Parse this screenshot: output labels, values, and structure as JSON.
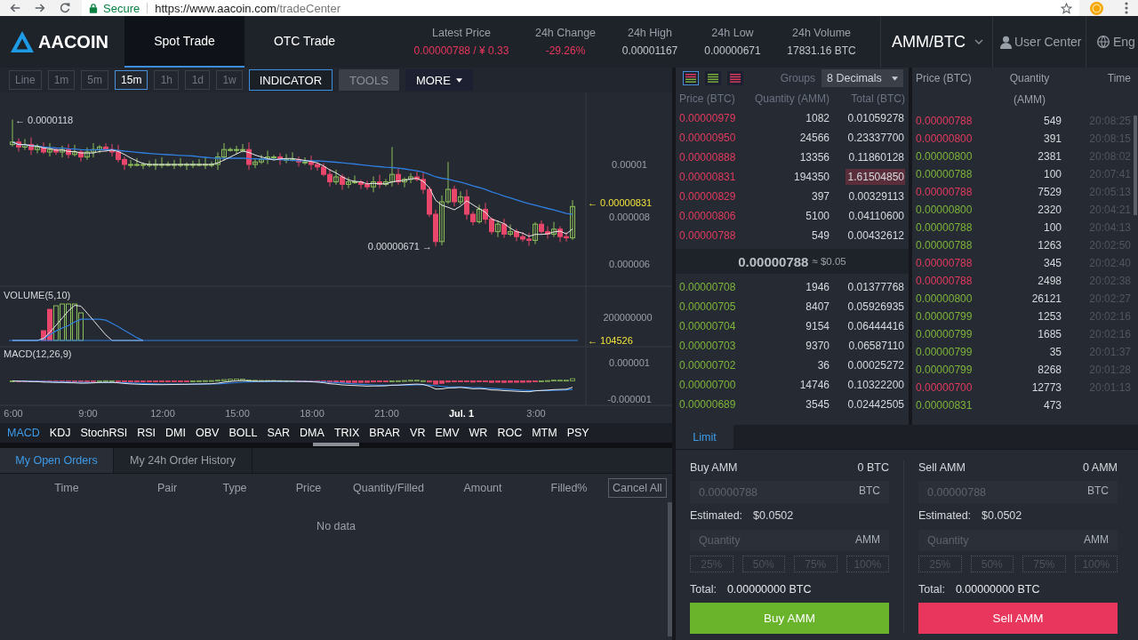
{
  "browser": {
    "secure": "Secure",
    "url_host": "https://www.aacoin.com",
    "url_path": "/tradeCenter"
  },
  "header": {
    "brand": "AACOIN",
    "nav": [
      {
        "label": "Spot Trade",
        "selected": true
      },
      {
        "label": "OTC Trade",
        "selected": false
      }
    ],
    "stats": [
      {
        "label": "Latest Price",
        "value": "0.00000788 / ¥ 0.33",
        "kind": "negative"
      },
      {
        "label": "24h Change",
        "value": "-29.26%",
        "kind": "negative"
      },
      {
        "label": "24h High",
        "value": "0.00001167",
        "kind": "neutral"
      },
      {
        "label": "24h Low",
        "value": "0.00000671",
        "kind": "neutral"
      },
      {
        "label": "24h Volume",
        "value": "17831.16 BTC",
        "kind": "neutral"
      }
    ],
    "pair": "AMM/BTC",
    "user": "User Center",
    "language": "Eng"
  },
  "chart": {
    "intervals": [
      {
        "label": "Line",
        "selected": false
      },
      {
        "label": "1m",
        "selected": false
      },
      {
        "label": "5m",
        "selected": false
      },
      {
        "label": "15m",
        "selected": true
      },
      {
        "label": "1h",
        "selected": false
      },
      {
        "label": "1d",
        "selected": false
      },
      {
        "label": "1w",
        "selected": false
      }
    ],
    "tools": [
      {
        "label": "INDICATOR",
        "kind": "outlined"
      },
      {
        "label": "TOOLS",
        "kind": "muted"
      },
      {
        "label": "MORE",
        "kind": "menu"
      }
    ],
    "price_pane": {
      "high_label": "← 0.0000118",
      "low_label": "0.00000671 →",
      "last_label": "← 0.00000831",
      "y_ticks": [
        "0.00001",
        "0.000008",
        "0.000006"
      ]
    },
    "volume_pane": {
      "title": "VOLUME(5,10)",
      "y_ticks": [
        "200000000"
      ],
      "last_label": "← 104526"
    },
    "macd_pane": {
      "title": "MACD(12,26,9)",
      "y_ticks": [
        "0.000001",
        "-0.000001"
      ]
    },
    "x_ticks": [
      {
        "label": "6:00",
        "kind": "time"
      },
      {
        "label": "9:00",
        "kind": "time"
      },
      {
        "label": "12:00",
        "kind": "time"
      },
      {
        "label": "15:00",
        "kind": "time"
      },
      {
        "label": "18:00",
        "kind": "time"
      },
      {
        "label": "21:00",
        "kind": "time"
      },
      {
        "label": "Jul. 1",
        "kind": "date"
      },
      {
        "label": "3:00",
        "kind": "time"
      }
    ],
    "indicators": [
      {
        "label": "MACD",
        "selected": true
      },
      {
        "label": "KDJ",
        "selected": false
      },
      {
        "label": "StochRSI",
        "selected": false
      },
      {
        "label": "RSI",
        "selected": false
      },
      {
        "label": "DMI",
        "selected": false
      },
      {
        "label": "OBV",
        "selected": false
      },
      {
        "label": "BOLL",
        "selected": false
      },
      {
        "label": "SAR",
        "selected": false
      },
      {
        "label": "DMA",
        "selected": false
      },
      {
        "label": "TRIX",
        "selected": false
      },
      {
        "label": "BRAR",
        "selected": false
      },
      {
        "label": "VR",
        "selected": false
      },
      {
        "label": "EMV",
        "selected": false
      },
      {
        "label": "WR",
        "selected": false
      },
      {
        "label": "ROC",
        "selected": false
      },
      {
        "label": "MTM",
        "selected": false
      },
      {
        "label": "PSY",
        "selected": false
      }
    ]
  },
  "orders": {
    "tabs": [
      {
        "label": "My Open Orders",
        "selected": true
      },
      {
        "label": "My 24h Order History",
        "selected": false
      }
    ],
    "columns": [
      "Time",
      "Pair",
      "Type",
      "Price",
      "Quantity/Filled",
      "Amount",
      "Filled%"
    ],
    "cancel_all": "Cancel All",
    "empty": "No data"
  },
  "order_book": {
    "views": [
      {
        "kind": "both",
        "selected": true
      },
      {
        "kind": "bids",
        "selected": false
      },
      {
        "kind": "asks",
        "selected": false
      }
    ],
    "groups_label": "Groups",
    "decimals": "8 Decimals",
    "columns": [
      "Price (BTC)",
      "Quantity (AMM)",
      "Total (BTC)"
    ],
    "asks": [
      {
        "price": "0.00000979",
        "quantity": "1082",
        "total": "0.01059278",
        "highlighted": false
      },
      {
        "price": "0.00000950",
        "quantity": "24566",
        "total": "0.23337700",
        "highlighted": false
      },
      {
        "price": "0.00000888",
        "quantity": "13356",
        "total": "0.11860128",
        "highlighted": false
      },
      {
        "price": "0.00000831",
        "quantity": "194350",
        "total": "1.61504850",
        "highlighted": true
      },
      {
        "price": "0.00000829",
        "quantity": "397",
        "total": "0.00329113",
        "highlighted": false
      },
      {
        "price": "0.00000806",
        "quantity": "5100",
        "total": "0.04110600",
        "highlighted": false
      },
      {
        "price": "0.00000788",
        "quantity": "549",
        "total": "0.00432612",
        "highlighted": false
      }
    ],
    "last_price": "0.00000788",
    "last_price_usd": "≈ $0.05",
    "bids": [
      {
        "price": "0.00000708",
        "quantity": "1946",
        "total": "0.01377768"
      },
      {
        "price": "0.00000705",
        "quantity": "8407",
        "total": "0.05926935"
      },
      {
        "price": "0.00000704",
        "quantity": "9154",
        "total": "0.06444416"
      },
      {
        "price": "0.00000703",
        "quantity": "9370",
        "total": "0.06587110"
      },
      {
        "price": "0.00000702",
        "quantity": "36",
        "total": "0.00025272"
      },
      {
        "price": "0.00000700",
        "quantity": "14746",
        "total": "0.10322200"
      },
      {
        "price": "0.00000689",
        "quantity": "3545",
        "total": "0.02442505"
      }
    ]
  },
  "trades": {
    "columns": [
      "Price (BTC)",
      "Quantity (AMM)",
      "Time"
    ],
    "rows": [
      {
        "price": "0.00000788",
        "quantity": "549",
        "time": "20:08:25",
        "color": "#e23a5e"
      },
      {
        "price": "0.00000800",
        "quantity": "391",
        "time": "20:08:15",
        "color": "#e23a5e"
      },
      {
        "price": "0.00000800",
        "quantity": "2381",
        "time": "20:08:02",
        "color": "#7fb43a"
      },
      {
        "price": "0.00000788",
        "quantity": "100",
        "time": "20:07:41",
        "color": "#7fb43a"
      },
      {
        "price": "0.00000788",
        "quantity": "7529",
        "time": "20:05:13",
        "color": "#e23a5e"
      },
      {
        "price": "0.00000800",
        "quantity": "2320",
        "time": "20:04:21",
        "color": "#7fb43a"
      },
      {
        "price": "0.00000788",
        "quantity": "100",
        "time": "20:04:13",
        "color": "#7fb43a"
      },
      {
        "price": "0.00000788",
        "quantity": "1263",
        "time": "20:02:50",
        "color": "#7fb43a"
      },
      {
        "price": "0.00000788",
        "quantity": "345",
        "time": "20:02:40",
        "color": "#e23a5e"
      },
      {
        "price": "0.00000788",
        "quantity": "2498",
        "time": "20:02:38",
        "color": "#e23a5e"
      },
      {
        "price": "0.00000800",
        "quantity": "26121",
        "time": "20:02:27",
        "color": "#7fb43a"
      },
      {
        "price": "0.00000799",
        "quantity": "1253",
        "time": "20:02:16",
        "color": "#7fb43a"
      },
      {
        "price": "0.00000799",
        "quantity": "1685",
        "time": "20:02:16",
        "color": "#7fb43a"
      },
      {
        "price": "0.00000799",
        "quantity": "35",
        "time": "20:01:37",
        "color": "#7fb43a"
      },
      {
        "price": "0.00000799",
        "quantity": "8268",
        "time": "20:01:28",
        "color": "#7fb43a"
      },
      {
        "price": "0.00000700",
        "quantity": "12773",
        "time": "20:01:13",
        "color": "#e23a5e"
      },
      {
        "price": "0.00000831",
        "quantity": "473",
        "color": "#7fb43a"
      }
    ]
  },
  "order_form": {
    "tabs": [
      {
        "label": "Limit",
        "selected": true
      }
    ],
    "panels": [
      {
        "kind": "buy",
        "title": "Buy AMM",
        "balance": "0 BTC",
        "price_placeholder": "0.00000788",
        "price_unit": "BTC",
        "estimated_label": "Estimated:",
        "estimated": "$0.0502",
        "quantity_placeholder": "Quantity",
        "quantity_unit": "AMM",
        "percents": [
          "25%",
          "50%",
          "75%",
          "100%"
        ],
        "total_label": "Total:",
        "total": "0.00000000 BTC",
        "button": "Buy AMM"
      },
      {
        "kind": "sell",
        "title": "Sell AMM",
        "balance": "0 AMM",
        "price_placeholder": "0.00000788",
        "price_unit": "BTC",
        "estimated_label": "Estimated:",
        "estimated": "$0.0502",
        "quantity_placeholder": "Quantity",
        "quantity_unit": "AMM",
        "percents": [
          "25%",
          "50%",
          "75%",
          "100%"
        ],
        "total_label": "Total:",
        "total": "0.00000000 BTC",
        "button": "Sell AMM"
      }
    ]
  }
}
